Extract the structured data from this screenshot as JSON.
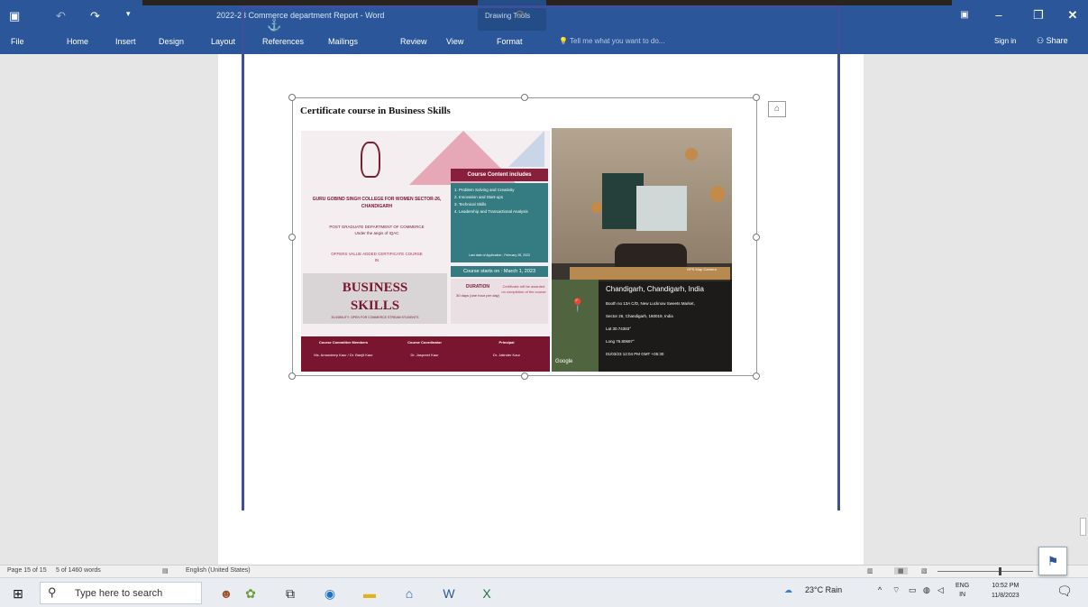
{
  "window": {
    "title": "2022-23 Commerce department Report - Word",
    "context_group": "Drawing Tools",
    "context_tab": "Format",
    "controls": [
      "restore-ribbon",
      "minimize",
      "maximize",
      "close"
    ]
  },
  "ribbon": {
    "tabs": [
      "File",
      "Home",
      "Insert",
      "Design",
      "Layout",
      "References",
      "Mailings",
      "Review",
      "View"
    ],
    "tell_me": "Tell me what you want to do...",
    "sign_in": "Sign in",
    "share": "Share"
  },
  "document": {
    "caption": "Certificate course in Business Skills",
    "poster": {
      "college": "GURU GOBIND SINGH COLLEGE FOR WOMEN SECTOR-26, CHANDIGARH",
      "dept": "POST GRADUATE DEPARTMENT OF COMMERCE",
      "aegis": "Under the aegis of IQAC",
      "offers": "OFFERS VALUE ADDED CERTIFICATE COURSE",
      "in": "IN",
      "title1": "BUSINESS",
      "title2": "SKILLS",
      "eligibility": "ELIGIBILITY: OPEN FOR COMMERCE STREAM STUDENTS",
      "content_head": "Course Content includes",
      "content_items": [
        "1. Problem Solving and Creativity",
        "2. Innovation and Start-ups",
        "3. Technical Skills",
        "4. Leadership and Transactional Analysis"
      ],
      "last_date": "Last date of Application : February 28, 2023",
      "starts": "Course starts on : March 1, 2023",
      "duration_label": "DURATION",
      "duration_value": "30 days (one hour per day)",
      "certificate": "Certificate will be awarded on completion of the course",
      "footer_heads": [
        "Course Committee Members",
        "Course Coordinator",
        "Principal"
      ],
      "footer_names": [
        "Ms. Amandeep Kaur / Dr. Banjit Kaur",
        "Dr. Jaspreet Kaur",
        "Dr. Jatinder Kaur"
      ]
    },
    "photo": {
      "camera": "GPS Map Camera",
      "city": "Chandigarh, Chandigarh, India",
      "address1": "Booth no 13A C/D, New Lucknow Sweets Market,",
      "address2": "Sector 26, Chandigarh, 160019, India",
      "lat": "Lat 30.74383°",
      "long": "Long 76.80697°",
      "datetime": "01/03/23 12:04 PM GMT +05:30",
      "google": "Google"
    }
  },
  "statusbar": {
    "page": "Page 15 of 15",
    "words": "5 of 1460 words",
    "language": "English (United States)"
  },
  "taskbar": {
    "search_placeholder": "Type here to search",
    "weather": "23°C Rain",
    "lang": "ENG",
    "lang_sub": "IN",
    "time": "10:52 PM",
    "date": "11/8/2023"
  }
}
